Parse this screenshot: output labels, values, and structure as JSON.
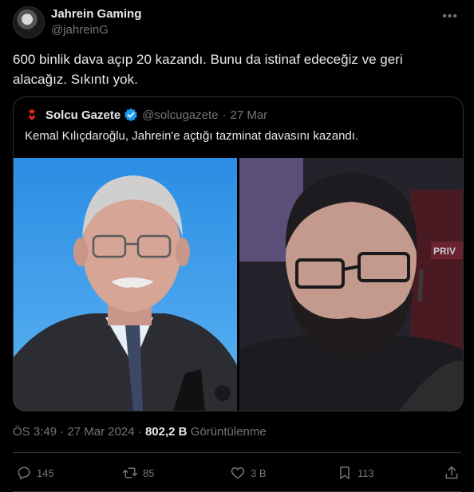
{
  "author": {
    "name": "Jahrein Gaming",
    "handle": "@jahreinG"
  },
  "tweet": {
    "text": "600 binlik dava açıp 20 kazandı. Bunu da istinaf edeceğiz ve geri alacağız. Sıkıntı yok."
  },
  "quote": {
    "name": "Solcu Gazete",
    "handle": "@solcugazete",
    "separator": "·",
    "date": "27 Mar",
    "text": "Kemal Kılıçdaroğlu, Jahrein'e açtığı tazminat davasını kazandı."
  },
  "meta": {
    "time": "ÖS 3:49",
    "separator": "·",
    "date": "27 Mar 2024",
    "views": "802,2 B",
    "views_label": "Görüntülenme"
  },
  "actions": {
    "replies": "145",
    "reposts": "85",
    "likes": "3 B",
    "bookmarks": "113"
  },
  "colors": {
    "background": "#000000",
    "text": "#e7e9ea",
    "muted": "#71767b",
    "border": "#2f3336",
    "verified": "#1d9bf0"
  }
}
